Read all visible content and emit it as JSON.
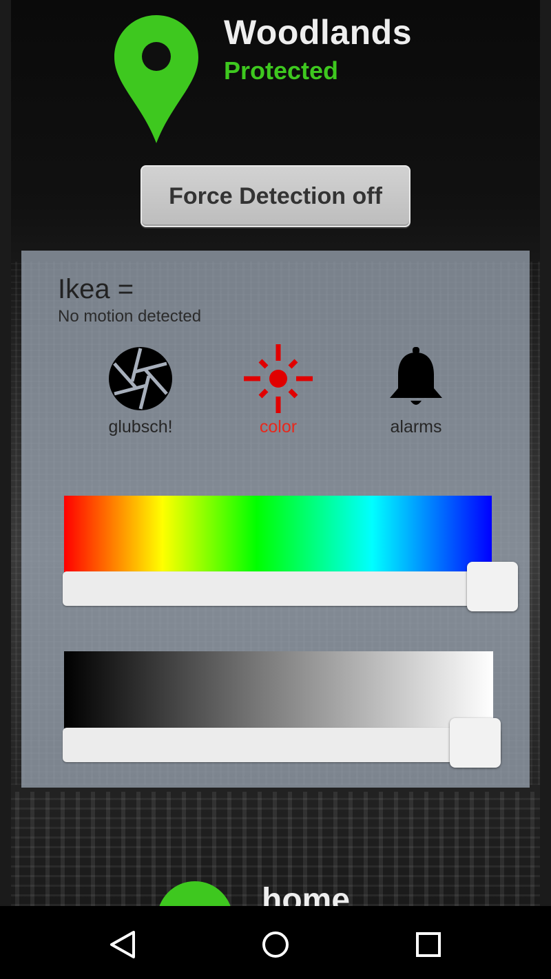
{
  "header": {
    "title": "Woodlands",
    "status": "Protected"
  },
  "force_button": {
    "label": "Force Detection off"
  },
  "device": {
    "name": "Ikea =",
    "status": "No motion detected",
    "actions": [
      {
        "label": "glubsch!",
        "icon": "camera-aperture-icon"
      },
      {
        "label": "color",
        "icon": "light-burst-icon"
      },
      {
        "label": "alarms",
        "icon": "bell-icon"
      }
    ]
  },
  "sliders": {
    "hue": {
      "value_fraction": 1.0
    },
    "brightness": {
      "value_fraction": 1.0
    }
  },
  "next_location": {
    "title": "home"
  },
  "colors": {
    "accent_green": "#3ec81f",
    "active_red": "#e8281c"
  },
  "nav": {
    "back_icon": "back-triangle-icon",
    "home_icon": "home-circle-icon",
    "recents_icon": "recents-square-icon"
  }
}
